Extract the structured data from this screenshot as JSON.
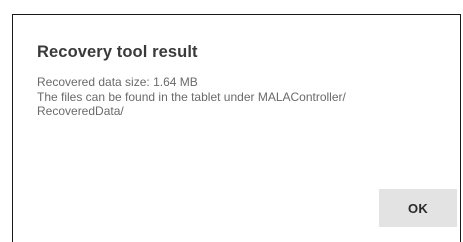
{
  "dialog": {
    "title": "Recovery tool result",
    "message_lines": [
      "Recovered data size: 1.64 MB",
      "The files can be found in the tablet under MALAController/",
      "RecoveredData/"
    ],
    "ok_label": "OK"
  }
}
